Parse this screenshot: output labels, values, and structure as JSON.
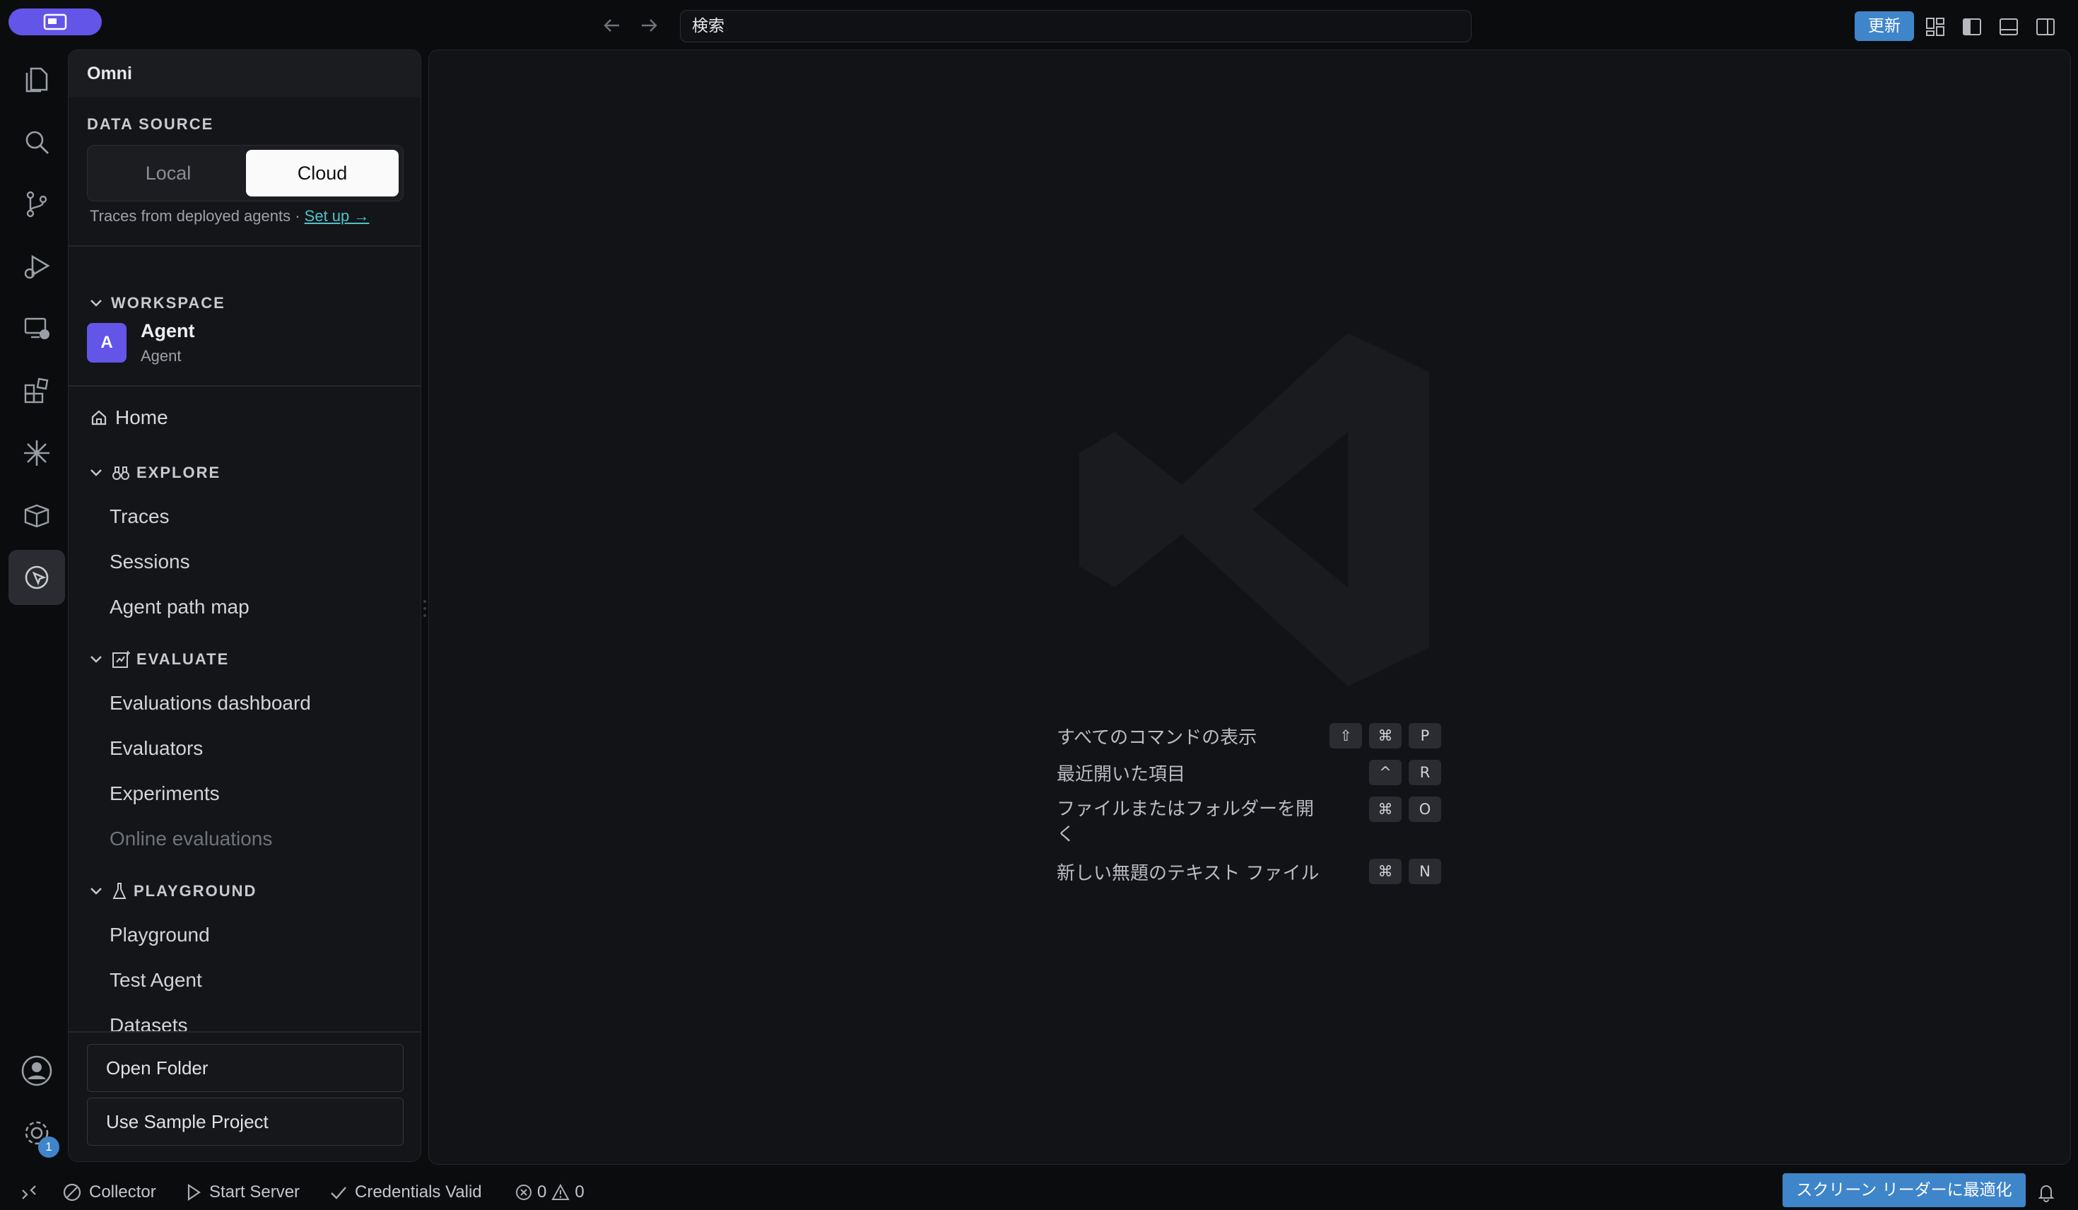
{
  "titlebar": {
    "search_placeholder": "検索",
    "update_label": "更新"
  },
  "activity_bar": {
    "icons": [
      "explorer-icon",
      "search-icon",
      "source-control-icon",
      "run-debug-icon",
      "remote-explorer-icon",
      "extensions-icon",
      "sparkle-icon",
      "package-icon",
      "omni-icon"
    ],
    "settings_badge": "1"
  },
  "sidebar": {
    "title": "Omni",
    "data_source": {
      "label": "DATA SOURCE",
      "options": [
        "Local",
        "Cloud"
      ],
      "selected": "Cloud",
      "hint": "Traces from deployed agents · ",
      "setup_link": "Set up →"
    },
    "workspace": {
      "label": "WORKSPACE",
      "avatar_letter": "A",
      "name": "Agent",
      "subtitle": "Agent"
    },
    "home": "Home",
    "explore": {
      "label": "EXPLORE",
      "items": [
        "Traces",
        "Sessions",
        "Agent path map"
      ]
    },
    "evaluate": {
      "label": "EVALUATE",
      "items": [
        "Evaluations dashboard",
        "Evaluators",
        "Experiments",
        "Online evaluations"
      ]
    },
    "playground": {
      "label": "PLAYGROUND",
      "items": [
        "Playground",
        "Test Agent",
        "Datasets"
      ]
    },
    "buttons": {
      "open_folder": "Open Folder",
      "use_sample": "Use Sample Project"
    }
  },
  "editor": {
    "shortcuts": [
      {
        "label": "すべてのコマンドの表示",
        "keys": [
          "⇧",
          "⌘",
          "P"
        ]
      },
      {
        "label": "最近開いた項目",
        "keys": [
          "^",
          "R"
        ]
      },
      {
        "label": "ファイルまたはフォルダーを開\nく",
        "keys": [
          "⌘",
          "O"
        ]
      },
      {
        "label": "新しい無題のテキスト ファイル",
        "keys": [
          "⌘",
          "N"
        ]
      }
    ]
  },
  "statusbar": {
    "collector": "Collector",
    "start_server": "Start Server",
    "credentials": "Credentials Valid",
    "errors": "0",
    "warnings": "0",
    "screen_reader": "スクリーン リーダーに最適化"
  },
  "colors": {
    "accent": "#6355e8",
    "button_blue": "#3f85c9",
    "link": "#4fc3c9"
  }
}
